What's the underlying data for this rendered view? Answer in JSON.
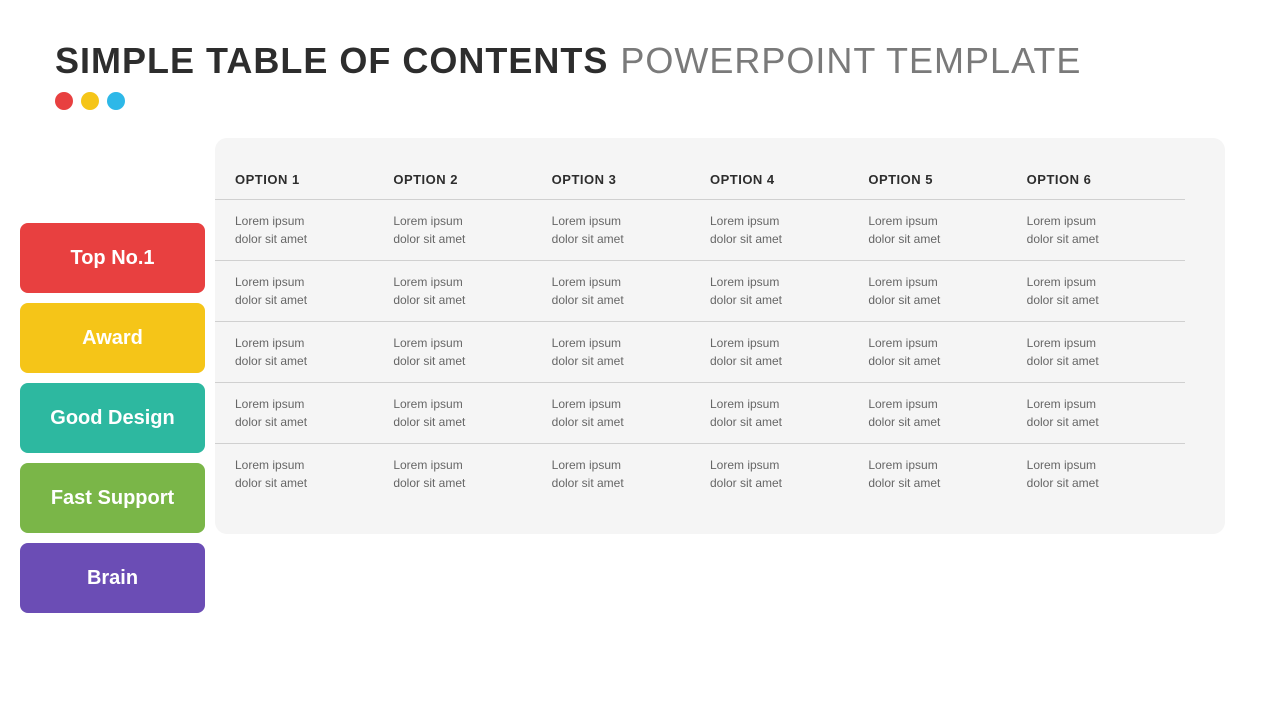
{
  "header": {
    "title_bold": "SIMPLE TABLE OF CONTENTS",
    "title_light": "POWERPOINT TEMPLATE"
  },
  "dots": [
    {
      "color_class": "dot-red"
    },
    {
      "color_class": "dot-yellow"
    },
    {
      "color_class": "dot-blue"
    }
  ],
  "columns": [
    {
      "label": "OPTION 1"
    },
    {
      "label": "OPTION 2"
    },
    {
      "label": "OPTION 3"
    },
    {
      "label": "OPTION 4"
    },
    {
      "label": "OPTION 5"
    },
    {
      "label": "OPTION 6"
    }
  ],
  "rows": [
    {
      "label": "Top No.1",
      "label_class": "label-red",
      "cells": [
        {
          "text": "Lorem ipsum\ndolor sit amet"
        },
        {
          "text": "Lorem ipsum\ndolor sit amet"
        },
        {
          "text": "Lorem ipsum\ndolor sit amet"
        },
        {
          "text": "Lorem ipsum\ndolor sit amet"
        },
        {
          "text": "Lorem ipsum\ndolor sit amet"
        },
        {
          "text": "Lorem ipsum\ndolor sit amet"
        }
      ]
    },
    {
      "label": "Award",
      "label_class": "label-yellow",
      "cells": [
        {
          "text": "Lorem ipsum\ndolor sit amet"
        },
        {
          "text": "Lorem ipsum\ndolor sit amet"
        },
        {
          "text": "Lorem ipsum\ndolor sit amet"
        },
        {
          "text": "Lorem ipsum\ndolor sit amet"
        },
        {
          "text": "Lorem ipsum\ndolor sit amet"
        },
        {
          "text": "Lorem ipsum\ndolor sit amet"
        }
      ]
    },
    {
      "label": "Good Design",
      "label_class": "label-teal",
      "cells": [
        {
          "text": "Lorem ipsum\ndolor sit amet"
        },
        {
          "text": "Lorem ipsum\ndolor sit amet"
        },
        {
          "text": "Lorem ipsum\ndolor sit amet"
        },
        {
          "text": "Lorem ipsum\ndolor sit amet"
        },
        {
          "text": "Lorem ipsum\ndolor sit amet"
        },
        {
          "text": "Lorem ipsum\ndolor sit amet"
        }
      ]
    },
    {
      "label": "Fast Support",
      "label_class": "label-green",
      "cells": [
        {
          "text": "Lorem ipsum\ndolor sit amet"
        },
        {
          "text": "Lorem ipsum\ndolor sit amet"
        },
        {
          "text": "Lorem ipsum\ndolor sit amet"
        },
        {
          "text": "Lorem ipsum\ndolor sit amet"
        },
        {
          "text": "Lorem ipsum\ndolor sit amet"
        },
        {
          "text": "Lorem ipsum\ndolor sit amet"
        }
      ]
    },
    {
      "label": "Brain",
      "label_class": "label-purple",
      "cells": [
        {
          "text": "Lorem ipsum\ndolor sit amet"
        },
        {
          "text": "Lorem ipsum\ndolor sit amet"
        },
        {
          "text": "Lorem ipsum\ndolor sit amet"
        },
        {
          "text": "Lorem ipsum\ndolor sit amet"
        },
        {
          "text": "Lorem ipsum\ndolor sit amet"
        },
        {
          "text": "Lorem ipsum\ndolor sit amet"
        }
      ]
    }
  ]
}
